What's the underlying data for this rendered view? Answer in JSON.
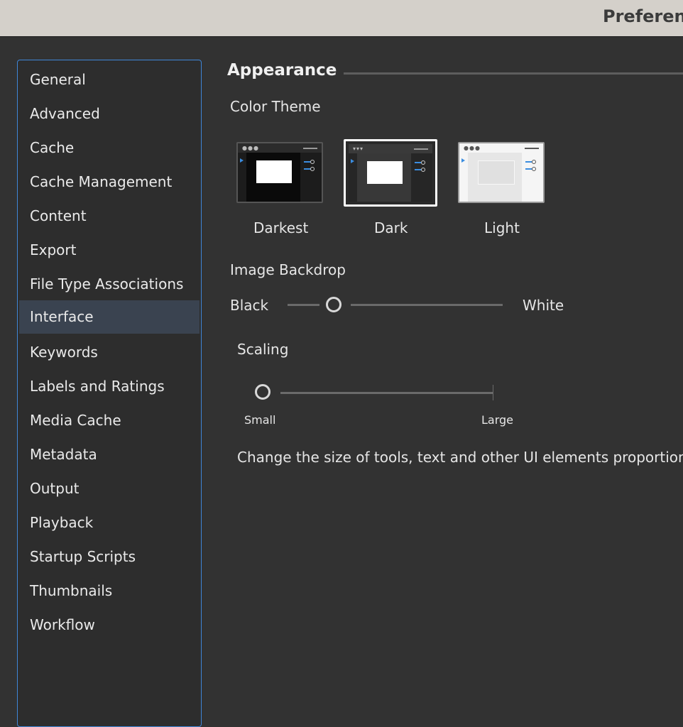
{
  "window": {
    "title": "Preferences"
  },
  "sidebar": {
    "items": [
      {
        "label": "General"
      },
      {
        "label": "Advanced"
      },
      {
        "label": "Cache"
      },
      {
        "label": "Cache Management"
      },
      {
        "label": "Content"
      },
      {
        "label": "Export"
      },
      {
        "label": "File Type Associations"
      },
      {
        "label": "Interface",
        "selected": true
      },
      {
        "label": "Keywords"
      },
      {
        "label": "Labels and Ratings"
      },
      {
        "label": "Media Cache"
      },
      {
        "label": "Metadata"
      },
      {
        "label": "Output"
      },
      {
        "label": "Playback"
      },
      {
        "label": "Startup Scripts"
      },
      {
        "label": "Thumbnails"
      },
      {
        "label": "Workflow"
      }
    ],
    "accent_color": "#3f86d8",
    "selected_bg": "#3a4350"
  },
  "appearance": {
    "title": "Appearance",
    "color_theme": {
      "label": "Color Theme",
      "selected": "Dark",
      "options": [
        {
          "label": "Darkest"
        },
        {
          "label": "Dark"
        },
        {
          "label": "Light"
        }
      ]
    },
    "image_backdrop": {
      "label": "Image Backdrop",
      "min_label": "Black",
      "max_label": "White",
      "value": 0.22
    },
    "scaling": {
      "label": "Scaling",
      "min_label": "Small",
      "max_label": "Large",
      "value": 0.0,
      "description": "Change the size of tools, text and other UI elements proportionat"
    }
  }
}
